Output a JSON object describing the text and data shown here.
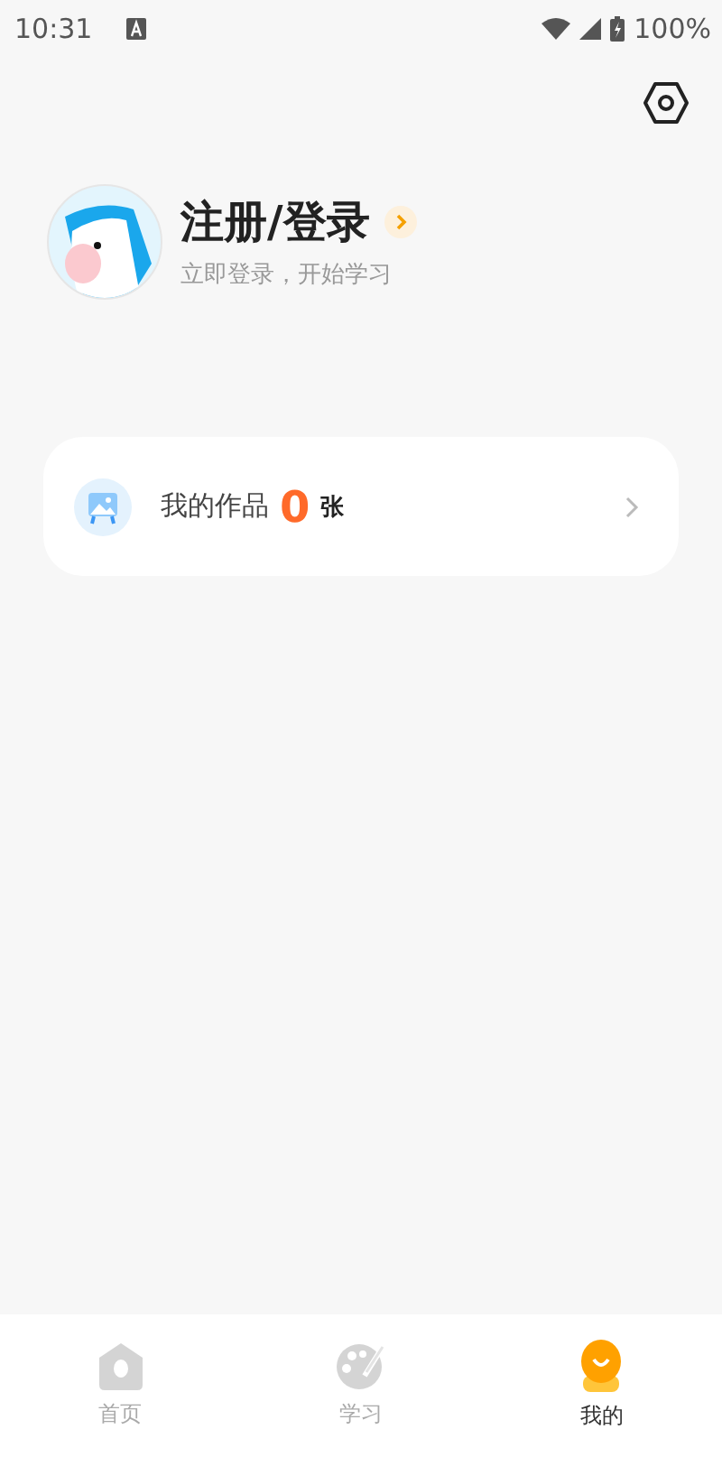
{
  "status_bar": {
    "time": "10:31",
    "battery": "100%"
  },
  "profile": {
    "title": "注册/登录",
    "subtitle": "立即登录，开始学习"
  },
  "works": {
    "label": "我的作品",
    "count": "0",
    "unit": "张"
  },
  "tabs": [
    {
      "kind": "home",
      "label": "首页",
      "selected": false
    },
    {
      "kind": "palette",
      "label": "学习",
      "selected": false
    },
    {
      "kind": "mine",
      "label": "我的",
      "selected": true
    }
  ]
}
